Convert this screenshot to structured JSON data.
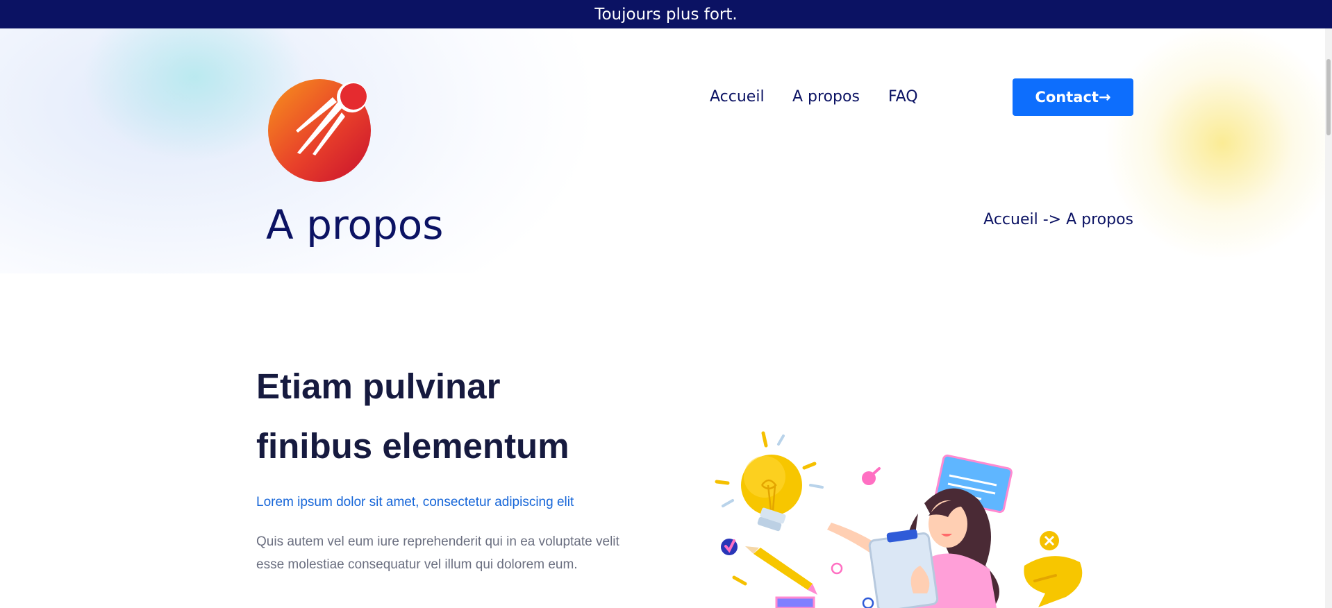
{
  "announcement": "Toujours plus fort.",
  "nav": {
    "items": [
      "Accueil",
      "A propos",
      "FAQ"
    ],
    "contact_label": "Contact→"
  },
  "hero": {
    "title": "A propos",
    "breadcrumb": {
      "home": "Accueil",
      "separator": " -> ",
      "current": "A propos"
    }
  },
  "about": {
    "heading_line1": "Etiam pulvinar",
    "heading_line2": "finibus elementum",
    "subheading": "Lorem ipsum dolor sit amet, consectetur adipiscing elit",
    "body": "Quis autem vel eum iure reprehenderit qui in ea voluptate velit esse molestiae consequatur vel illum qui dolorem eum."
  },
  "colors": {
    "topbar": "#0b1263",
    "navy_text": "#0b1263",
    "primary_button": "#0d6efd",
    "heading": "#161a3f",
    "accent_link": "#1565d8",
    "body_text": "#6b6f80"
  },
  "icons": [
    "comet-logo",
    "idea-illustration"
  ]
}
